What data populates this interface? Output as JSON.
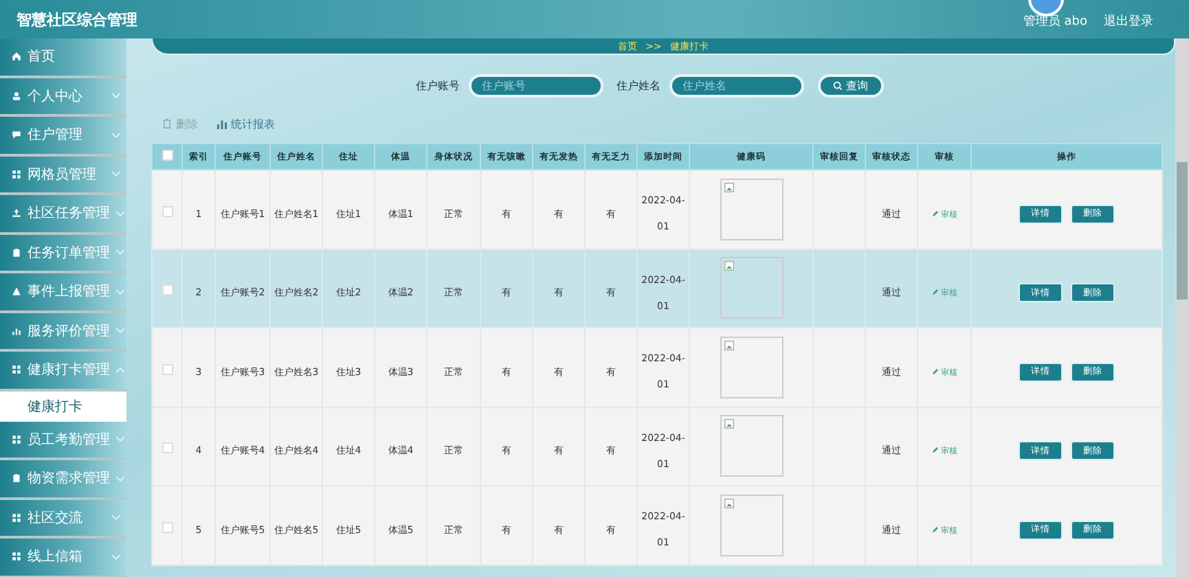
{
  "app_title": "智慧社区综合管理",
  "header": {
    "user": "管理员 abo",
    "logout": "退出登录"
  },
  "sidebar": {
    "items": [
      {
        "label": "首页",
        "has_submenu": false
      },
      {
        "label": "个人中心",
        "has_submenu": true,
        "expanded": false
      },
      {
        "label": "住户管理",
        "has_submenu": true,
        "expanded": false
      },
      {
        "label": "网格员管理",
        "has_submenu": true,
        "expanded": false
      },
      {
        "label": "社区任务管理",
        "has_submenu": true,
        "expanded": false
      },
      {
        "label": "任务订单管理",
        "has_submenu": true,
        "expanded": false
      },
      {
        "label": "事件上报管理",
        "has_submenu": true,
        "expanded": false
      },
      {
        "label": "服务评价管理",
        "has_submenu": true,
        "expanded": false
      },
      {
        "label": "健康打卡管理",
        "has_submenu": true,
        "expanded": true,
        "children": [
          {
            "label": "健康打卡",
            "selected": true
          }
        ]
      },
      {
        "label": "员工考勤管理",
        "has_submenu": true,
        "expanded": false
      },
      {
        "label": "物资需求管理",
        "has_submenu": true,
        "expanded": false
      },
      {
        "label": "社区交流",
        "has_submenu": true,
        "expanded": false
      },
      {
        "label": "线上信箱",
        "has_submenu": true,
        "expanded": false
      }
    ]
  },
  "breadcrumb": {
    "items": [
      "首页",
      "健康打卡"
    ],
    "separator": ">>"
  },
  "search": {
    "fields": [
      {
        "label": "住户账号",
        "placeholder": "住户账号"
      },
      {
        "label": "住户姓名",
        "placeholder": "住户姓名"
      }
    ],
    "button": "查询"
  },
  "actions": [
    {
      "label": "删除",
      "disabled": true
    },
    {
      "label": "统计报表",
      "disabled": false
    }
  ],
  "table": {
    "select_all_checked": false,
    "columns": [
      "索引",
      "住户账号",
      "住户姓名",
      "住址",
      "体温",
      "身体状况",
      "有无咳嗽",
      "有无发热",
      "有无乏力",
      "添加时间",
      "健康码",
      "审核回复",
      "审核状态",
      "审核",
      "操作"
    ],
    "rows": [
      {
        "checked": false,
        "highlighted": false,
        "index": "1",
        "account": "住户账号1",
        "name": "住户姓名1",
        "address": "住址1",
        "temperature": "体温1",
        "condition": "正常",
        "cough": "有",
        "fever": "有",
        "fatigue": "有",
        "added": "2022-04-01",
        "status": "通过",
        "review": "审核",
        "buttons": [
          "详情",
          "删除"
        ]
      },
      {
        "checked": false,
        "highlighted": true,
        "index": "2",
        "account": "住户账号2",
        "name": "住户姓名2",
        "address": "住址2",
        "temperature": "体温2",
        "condition": "正常",
        "cough": "有",
        "fever": "有",
        "fatigue": "有",
        "added": "2022-04-01",
        "status": "通过",
        "review": "审核",
        "buttons": [
          "详情",
          "删除"
        ]
      },
      {
        "checked": false,
        "highlighted": false,
        "index": "3",
        "account": "住户账号3",
        "name": "住户姓名3",
        "address": "住址3",
        "temperature": "体温3",
        "condition": "正常",
        "cough": "有",
        "fever": "有",
        "fatigue": "有",
        "added": "2022-04-01",
        "status": "通过",
        "review": "审核",
        "buttons": [
          "详情",
          "删除"
        ]
      },
      {
        "checked": false,
        "highlighted": false,
        "index": "4",
        "account": "住户账号4",
        "name": "住户姓名4",
        "address": "住址4",
        "temperature": "体温4",
        "condition": "正常",
        "cough": "有",
        "fever": "有",
        "fatigue": "有",
        "added": "2022-04-01",
        "status": "通过",
        "review": "审核",
        "buttons": [
          "详情",
          "删除"
        ]
      },
      {
        "checked": false,
        "highlighted": false,
        "index": "5",
        "account": "住户账号5",
        "name": "住户姓名5",
        "address": "住址5",
        "temperature": "体温5",
        "condition": "正常",
        "cough": "有",
        "fever": "有",
        "fatigue": "有",
        "added": "2022-04-01",
        "status": "通过",
        "review": "审核",
        "buttons": [
          "详情",
          "删除"
        ]
      }
    ]
  }
}
